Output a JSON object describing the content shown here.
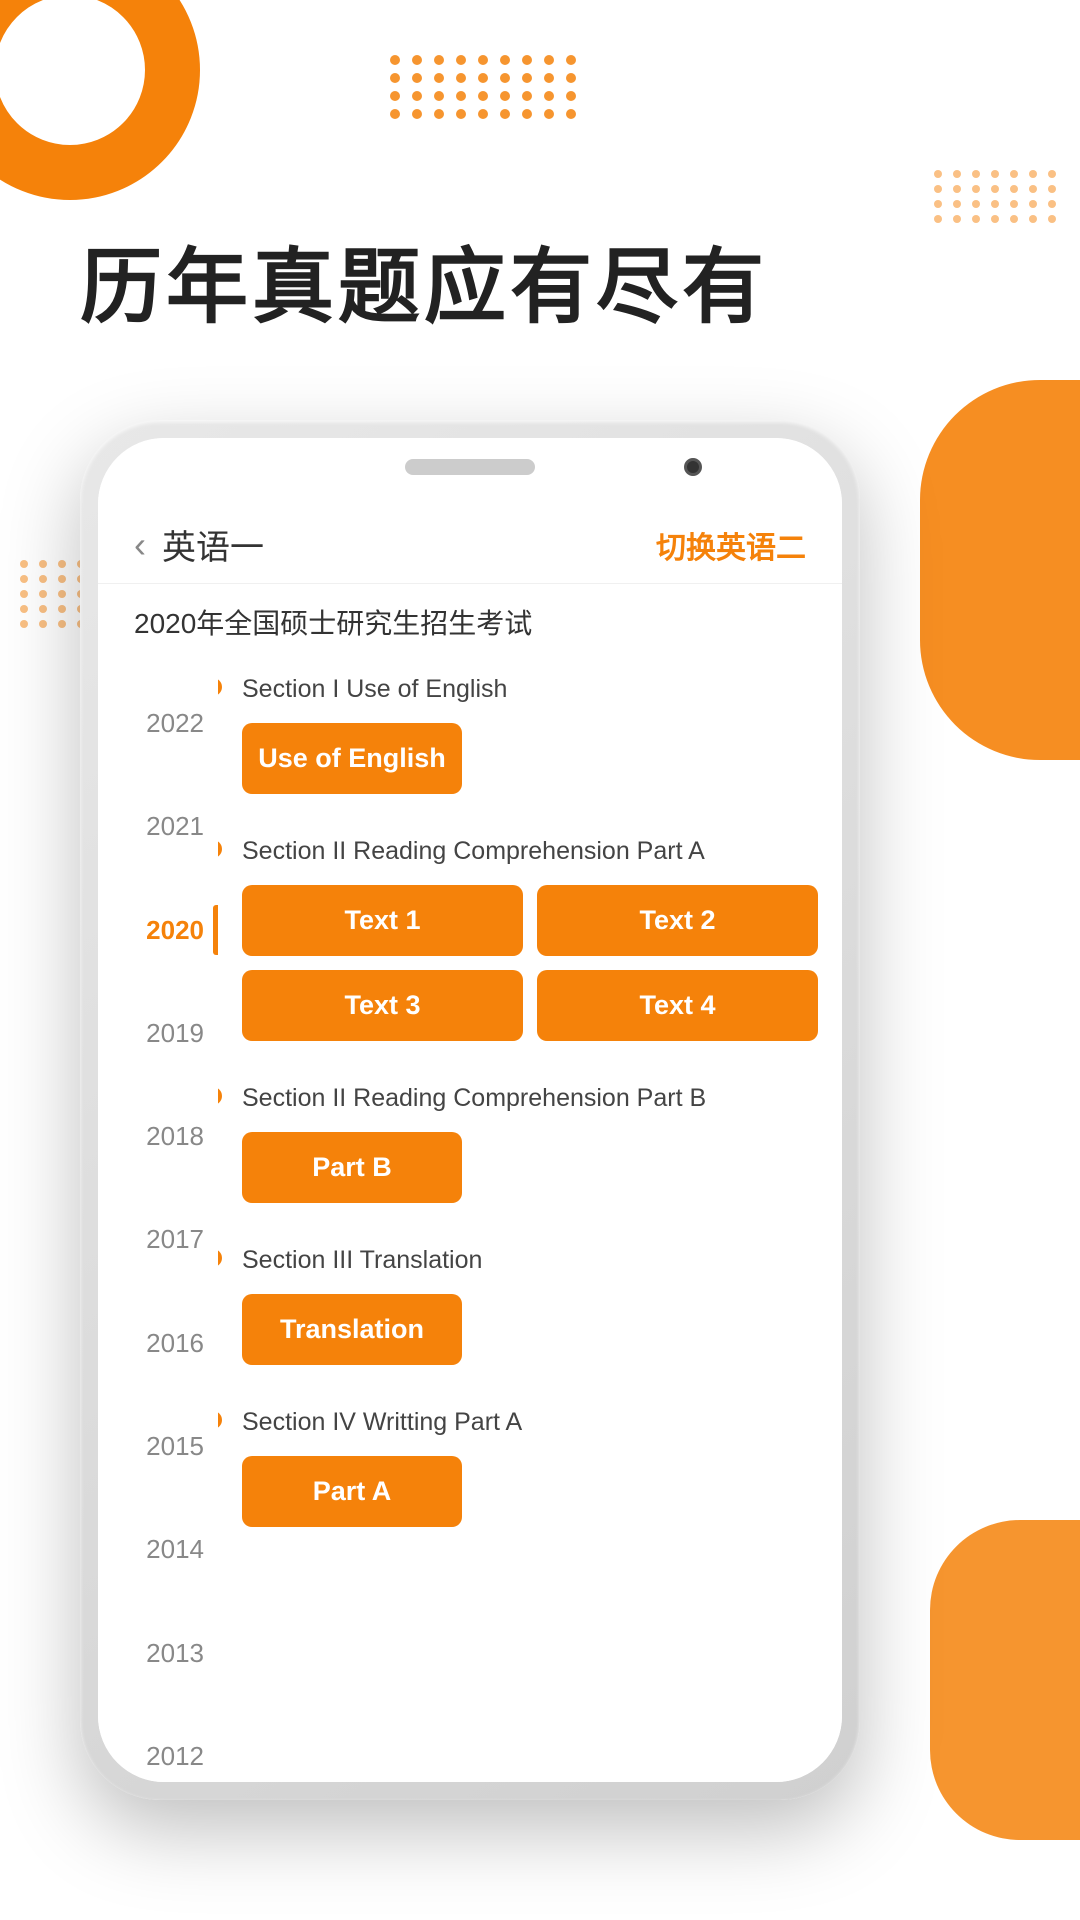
{
  "app": {
    "main_title": "历年真题应有尽有",
    "header": {
      "back_label": "‹",
      "title": "英语一",
      "switch_label": "切换英语二"
    },
    "subtitle": "2020年全国硕士研究生招生考试",
    "years": [
      {
        "year": "2022",
        "active": false
      },
      {
        "year": "2021",
        "active": false
      },
      {
        "year": "2020",
        "active": true
      },
      {
        "year": "2019",
        "active": false
      },
      {
        "year": "2018",
        "active": false
      },
      {
        "year": "2017",
        "active": false
      },
      {
        "year": "2016",
        "active": false
      },
      {
        "year": "2015",
        "active": false
      },
      {
        "year": "2014",
        "active": false
      },
      {
        "year": "2013",
        "active": false
      },
      {
        "year": "2012",
        "active": false
      }
    ],
    "sections": [
      {
        "id": "section1",
        "title": "Section I Use of English",
        "buttons": [
          {
            "label": "Use of English"
          }
        ]
      },
      {
        "id": "section2",
        "title": "Section II Reading Comprehension Part A",
        "buttons": [
          {
            "label": "Text 1"
          },
          {
            "label": "Text 2"
          },
          {
            "label": "Text 3"
          },
          {
            "label": "Text 4"
          }
        ]
      },
      {
        "id": "section3",
        "title": "Section II Reading Comprehension Part B",
        "buttons": [
          {
            "label": "Part B"
          }
        ]
      },
      {
        "id": "section4",
        "title": "Section III Translation",
        "buttons": [
          {
            "label": "Translation"
          }
        ]
      },
      {
        "id": "section5",
        "title": "Section IV Writting Part A",
        "buttons": [
          {
            "label": "Part A"
          }
        ]
      }
    ]
  },
  "decorations": {
    "dots_top_rows": 4,
    "dots_top_cols": 9,
    "dots_right_rows": 4,
    "dots_right_cols": 7,
    "dots_left_rows": 5,
    "dots_left_cols": 6
  }
}
